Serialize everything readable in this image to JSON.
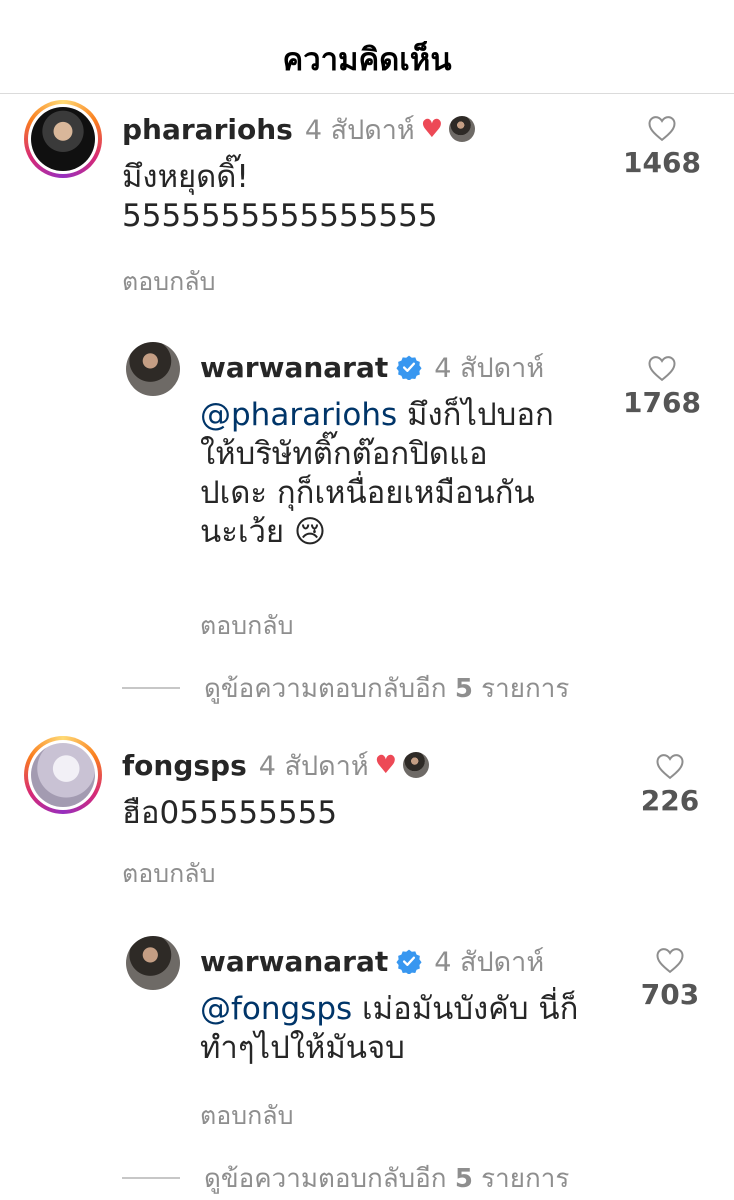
{
  "header": {
    "title": "ความคิดเห็น"
  },
  "comments": [
    {
      "username": "pharariohs",
      "time": "4 สัปดาห์",
      "line1": "มึงหยุดดิ๊!",
      "line2": "5555555555555555",
      "reply": "ตอบกลับ",
      "likes": "1468"
    },
    {
      "username": "warwanarat",
      "time": "4 สัปดาห์",
      "mention": "@pharariohs",
      "line1": "มึงก็ไปบอก",
      "line2": "ให้บริษัทติ๊กต๊อกปิดแอ",
      "line3": "ปเดะ กุก็เหนื่อยเหมือนกัน",
      "line4": "นะเว้ย 😢",
      "reply": "ตอบกลับ",
      "likes": "1768"
    },
    {
      "view_more_prefix": "ดูข้อความตอบกลับอีก",
      "view_more_count": "5",
      "view_more_suffix": "รายการ"
    },
    {
      "username": "fongsps",
      "time": "4 สัปดาห์",
      "line1": "ฮือ055555555",
      "reply": "ตอบกลับ",
      "likes": "226"
    },
    {
      "username": "warwanarat",
      "time": "4 สัปดาห์",
      "mention": "@fongsps",
      "line1": "เม่อมันบังคับ นี่ก็",
      "line2": "ทำๆไปให้มันจบ",
      "reply": "ตอบกลับ",
      "likes": "703"
    },
    {
      "view_more_prefix": "ดูข้อความตอบกลับอีก",
      "view_more_count": "5",
      "view_more_suffix": "รายการ"
    }
  ],
  "icons": {
    "heart_outline": "heart-outline-icon",
    "heart_filled": "heart-filled-icon",
    "verified": "verified-badge-icon"
  },
  "colors": {
    "like_red": "#ed4956",
    "verified_blue": "#3897f0",
    "mention": "#003569"
  }
}
